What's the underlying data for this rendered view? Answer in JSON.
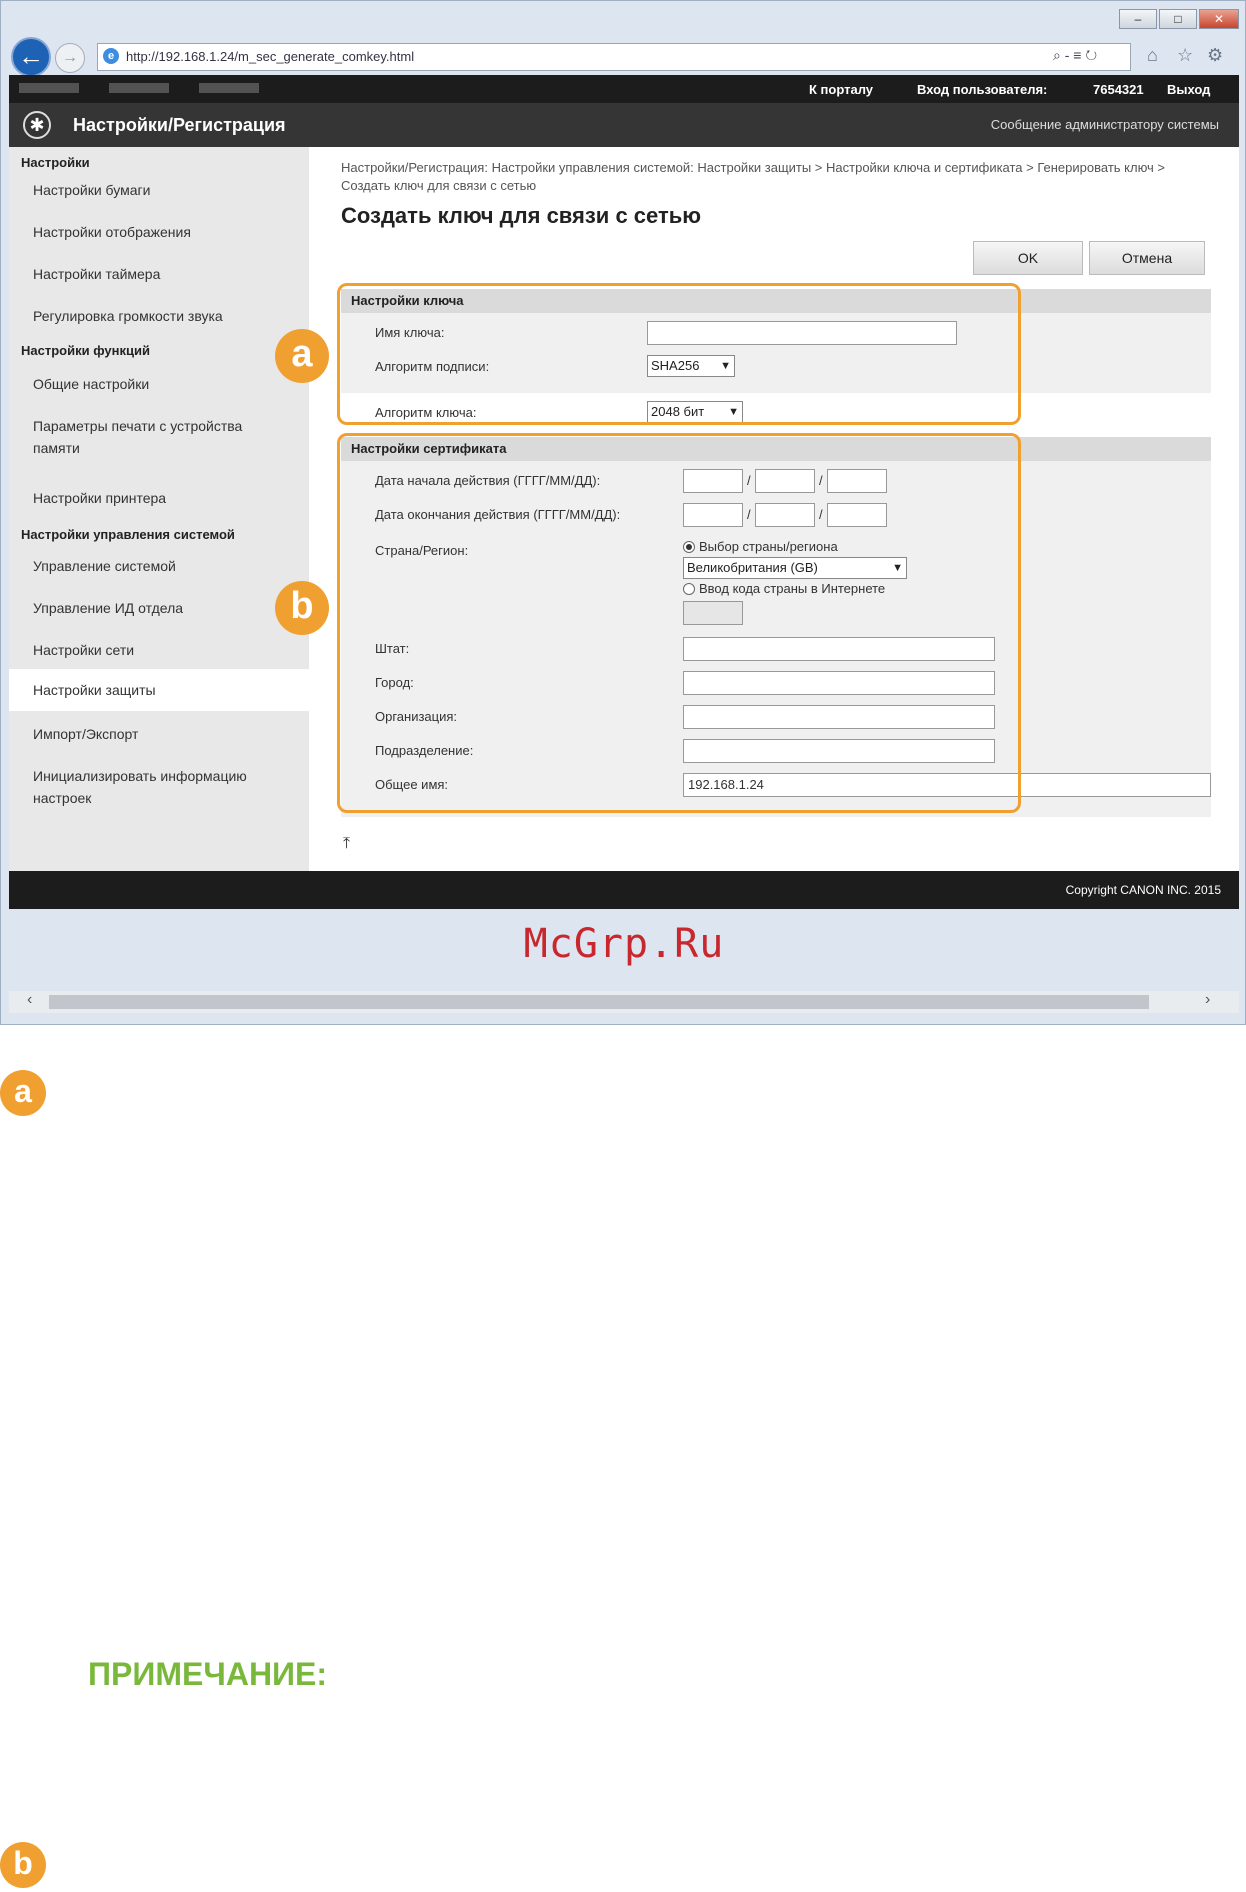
{
  "browser": {
    "url": "http://192.168.1.24/m_sec_generate_comkey.html",
    "search_symbol": "⌕ - ≡ ↻"
  },
  "topbar": {
    "portal_link": "К порталу",
    "login_label": "Вход пользователя:",
    "user_id": "7654321",
    "logout": "Выход"
  },
  "header": {
    "title": "Настройки/Регистрация",
    "admin_message": "Сообщение администратору системы"
  },
  "sidebar": {
    "section1": "Настройки",
    "s1_items": [
      "Настройки бумаги",
      "Настройки отображения",
      "Настройки таймера",
      "Регулировка громкости звука"
    ],
    "section2": "Настройки функций",
    "s2_items": [
      "Общие настройки",
      "Параметры печати с устройства памяти",
      "Настройки принтера"
    ],
    "section3": "Настройки управления системой",
    "s3_items": [
      "Управление системой",
      "Управление ИД отдела",
      "Настройки сети",
      "Настройки защиты",
      "Импорт/Экспорт",
      "Инициализировать информацию настроек"
    ]
  },
  "main": {
    "breadcrumb": "Настройки/Регистрация: Настройки управления системой: Настройки защиты > Настройки ключа и сертификата > Генерировать ключ > Создать ключ для связи с сетью",
    "title": "Создать ключ для связи с сетью",
    "ok_button": "OK",
    "cancel_button": "Отмена"
  },
  "key_settings": {
    "header": "Настройки ключа",
    "key_name_label": "Имя ключа:",
    "key_name_value": "",
    "sign_algo_label": "Алгоритм подписи:",
    "sign_algo_value": "SHA256",
    "key_algo_label": "Алгоритм ключа:",
    "key_algo_value": "2048 бит"
  },
  "cert_settings": {
    "header": "Настройки сертификата",
    "start_date_label": "Дата начала действия (ГГГГ/ММ/ДД):",
    "end_date_label": "Дата окончания действия (ГГГГ/ММ/ДД):",
    "country_label": "Страна/Регион:",
    "radio_select": "Выбор страны/региона",
    "country_value": "Великобритания (GB)",
    "radio_internet": "Ввод кода страны в Интернете",
    "state_label": "Штат:",
    "city_label": "Город:",
    "org_label": "Организация:",
    "unit_label": "Подразделение:",
    "common_name_label": "Общее имя:",
    "common_name_value": "192.168.1.24"
  },
  "footer": {
    "copyright": "Copyright CANON INC. 2015"
  },
  "watermark": "McGrp.Ru",
  "badges": {
    "a": "a",
    "b": "b"
  },
  "note_heading": "ПРИМЕЧАНИЕ:",
  "colors": {
    "accent": "#f0a030",
    "note": "#7ab83c",
    "watermark": "#c8272d"
  }
}
